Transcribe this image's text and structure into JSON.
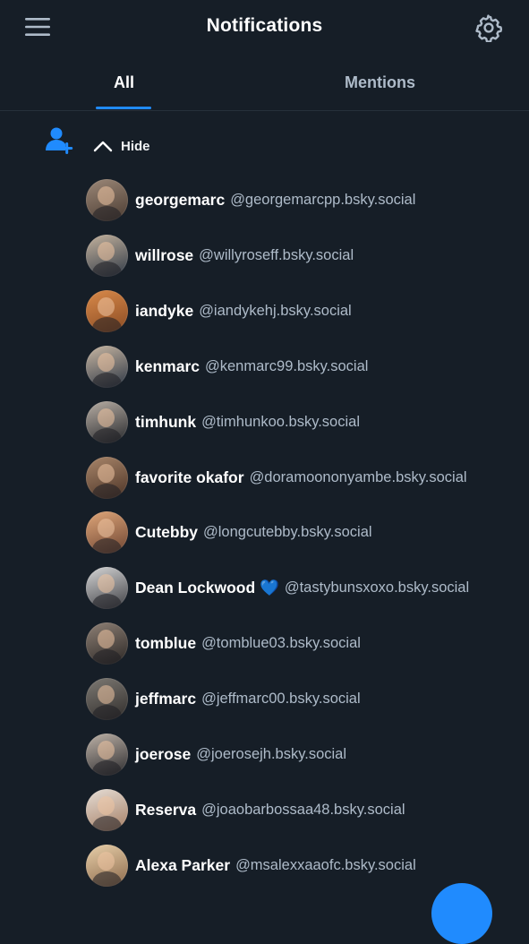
{
  "header": {
    "title": "Notifications",
    "menu_icon": "hamburger-menu-icon",
    "settings_icon": "gear-icon"
  },
  "tabs": [
    {
      "label": "All",
      "selected": true
    },
    {
      "label": "Mentions",
      "selected": false
    }
  ],
  "notification": {
    "type_icon": "person-plus-icon",
    "toggle_icon": "chevron-up-icon",
    "toggle_label": "Hide",
    "users": [
      {
        "name": "georgemarc",
        "handle": "@georgemarcpp.bsky.social"
      },
      {
        "name": "willrose",
        "handle": "@willyroseff.bsky.social"
      },
      {
        "name": "iandyke",
        "handle": "@iandykehj.bsky.social"
      },
      {
        "name": "kenmarc",
        "handle": "@kenmarc99.bsky.social"
      },
      {
        "name": "timhunk",
        "handle": "@timhunkoo.bsky.social"
      },
      {
        "name": "favorite okafor",
        "handle": "@doramoononyambe.bsky.social"
      },
      {
        "name": "Cutebby",
        "handle": "@longcutebby.bsky.social"
      },
      {
        "name": "Dean Lockwood 💙",
        "handle": "@tastybunsxoxo.bsky.social"
      },
      {
        "name": "tomblue",
        "handle": "@tomblue03.bsky.social"
      },
      {
        "name": "jeffmarc",
        "handle": "@jeffmarc00.bsky.social"
      },
      {
        "name": "joerose",
        "handle": "@joerosejh.bsky.social"
      },
      {
        "name": "Reserva",
        "handle": "@joaobarbossaa48.bsky.social"
      },
      {
        "name": "Alexa Parker",
        "handle": "@msalexxaaofc.bsky.social"
      }
    ]
  },
  "colors": {
    "background": "#161e27",
    "accent": "#208bfe",
    "text_primary": "#ffffff",
    "text_secondary": "#aebbc9",
    "divider": "#26303b"
  },
  "fab": {
    "icon": "compose-icon"
  }
}
